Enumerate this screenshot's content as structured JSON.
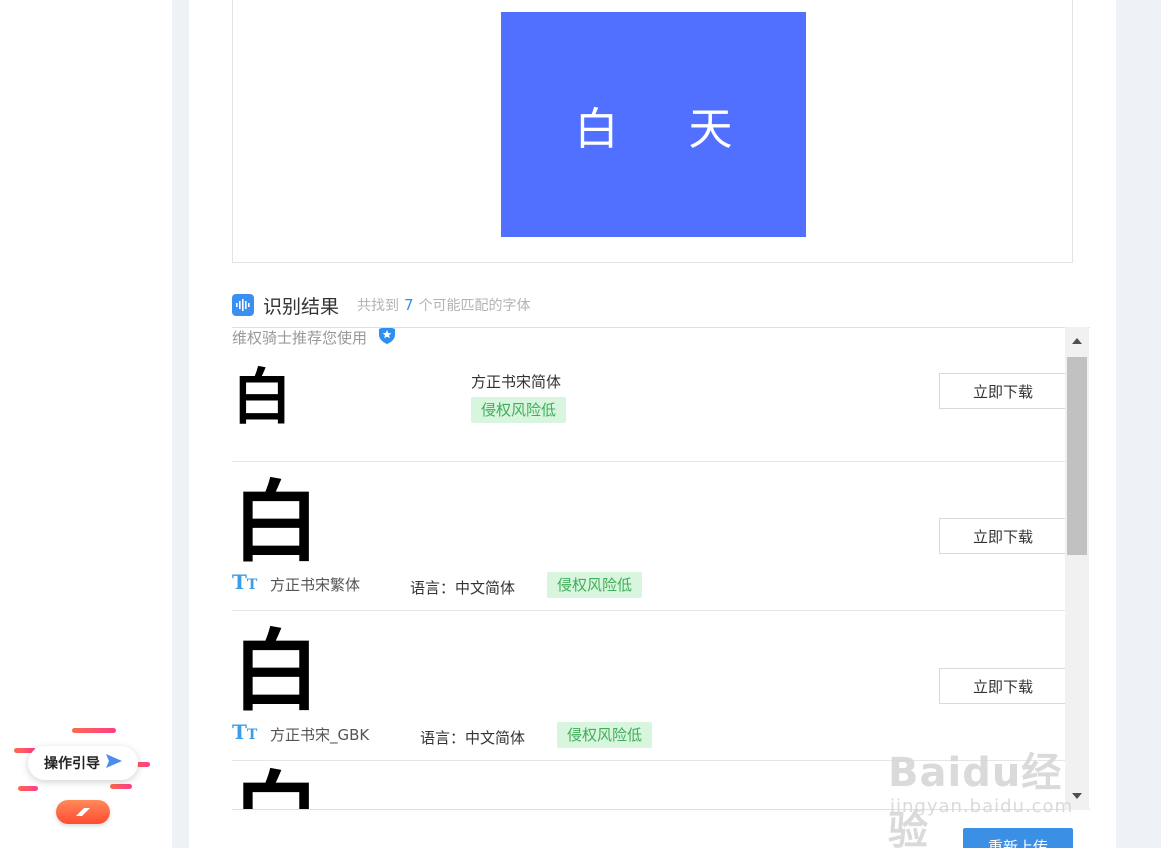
{
  "preview": {
    "text": "白 天",
    "bg_color": "#5170ff"
  },
  "result_header": {
    "title": "识别结果",
    "prefix": "共找到",
    "count": "7",
    "suffix": "个可能匹配的字体",
    "icon": "audio-wave-icon"
  },
  "recommend": {
    "text": "维权骑士推荐您使用",
    "icon": "shield-icon"
  },
  "results": [
    {
      "glyph": "白",
      "name": "方正书宋简体",
      "badge": "侵权风险低",
      "button": "立即下载"
    },
    {
      "glyph": "白",
      "name": "方正书宋繁体",
      "language": "语言：中文简体",
      "badge": "侵权风险低",
      "button": "立即下载",
      "icon": "font-tt-icon"
    },
    {
      "glyph": "白",
      "name": "方正书宋_GBK",
      "language": "语言：中文简体",
      "badge": "侵权风险低",
      "button": "立即下载",
      "icon": "font-tt-icon"
    },
    {
      "glyph": "白"
    }
  ],
  "reupload_button": "重新上传",
  "guide": {
    "label": "操作引导",
    "icon": "paper-plane-icon"
  },
  "watermark": {
    "top": "Baidu经验",
    "bottom": "jingyan.baidu.com"
  },
  "colors": {
    "accent": "#3b8fe4",
    "badge_bg": "#d8f5dd",
    "badge_text": "#3fae5a",
    "page_gutter": "#eef1f5"
  }
}
